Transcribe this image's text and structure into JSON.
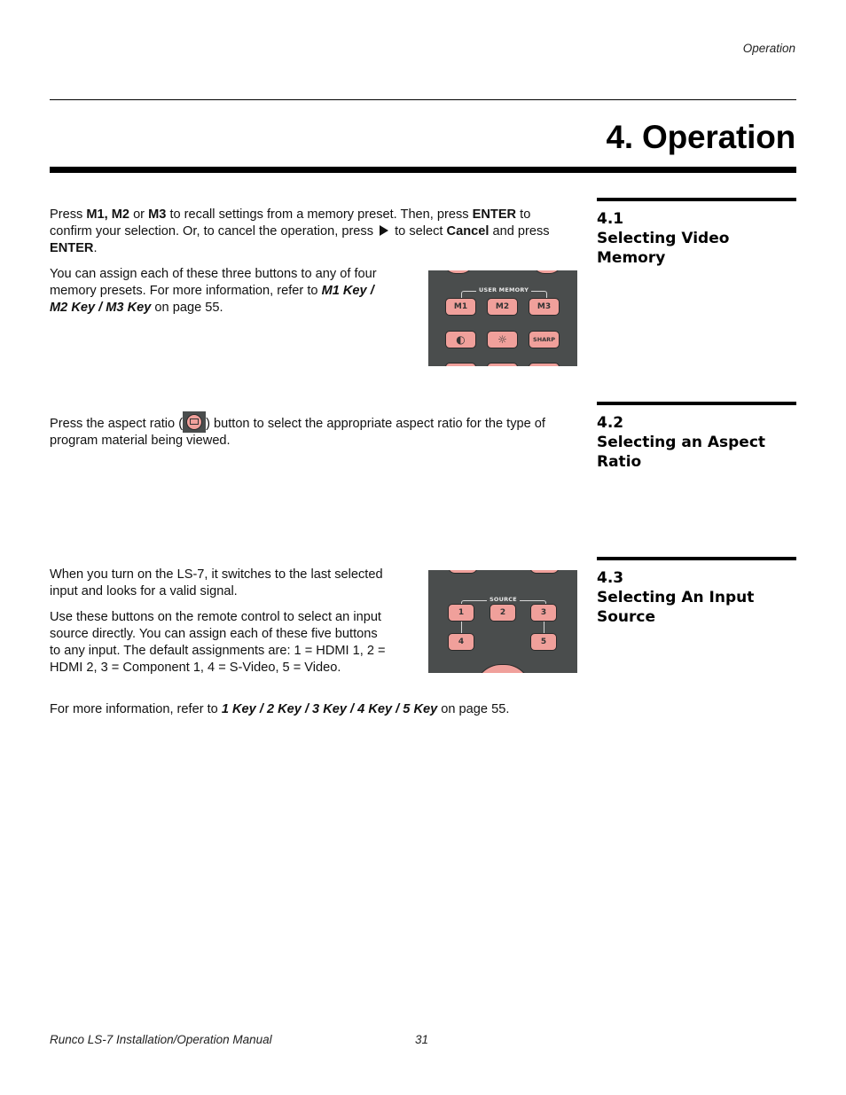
{
  "header": {
    "running_head": "Operation",
    "chapter_title": "4. Operation"
  },
  "sections": [
    {
      "number": "4.1",
      "title_line1": "Selecting Video",
      "title_line2": "Memory",
      "para1": {
        "t1": "Press ",
        "b1": "M1, M2",
        "t2": " or ",
        "b2": "M3",
        "t3": " to recall settings from a memory preset. Then, press ",
        "b3": "ENTER",
        "t4": " to confirm your selection. Or, to cancel the operation, press ",
        "t5": " to select ",
        "b4": "Cancel",
        "t6": " and press ",
        "b5": "ENTER",
        "t7": "."
      },
      "para2": {
        "t1": "You can assign each of these three buttons to any of four memory presets. For more information, refer to ",
        "bi1": "M1 Key / M2 Key / M3 Key",
        "t2": " on page 55."
      },
      "remote": {
        "group_label": "USER MEMORY",
        "buttons": [
          "M1",
          "M2",
          "M3"
        ],
        "row2": [
          "contrast-icon",
          "brightness-icon",
          "SHARP"
        ],
        "contrast_glyph": "◐",
        "brightness_glyph": "☼",
        "sharp_label": "SHARP"
      }
    },
    {
      "number": "4.2",
      "title_line1": "Selecting an Aspect",
      "title_line2": "Ratio",
      "para1": {
        "t1": "Press the aspect ratio (",
        "t2": ") button to select the appropriate aspect ratio for the type of program material being viewed."
      }
    },
    {
      "number": "4.3",
      "title_line1": "Selecting An Input",
      "title_line2": "Source",
      "para1": "When you turn on the LS-7, it switches to the last selected input and looks for a valid signal.",
      "para2": "Use these buttons on the remote control to select an input source directly. You can assign each of these five buttons to any input. The default assignments are: 1 = HDMI 1, 2 = HDMI 2, 3 = Component 1, 4 = S-Video, 5 = Video.",
      "para3": {
        "t1": "For more information, refer to ",
        "bi1": "1 Key / 2 Key / 3 Key / 4 Key / 5 Key",
        "t2": " on page 55."
      },
      "remote": {
        "group_label": "SOURCE",
        "buttons": [
          "1",
          "2",
          "3",
          "4",
          "5"
        ]
      }
    }
  ],
  "colors": {
    "remote_body": "#4a4d4d",
    "remote_button": "#f0a09b"
  },
  "footer": {
    "manual_title": "Runco LS-7 Installation/Operation Manual",
    "page_number": "31"
  }
}
